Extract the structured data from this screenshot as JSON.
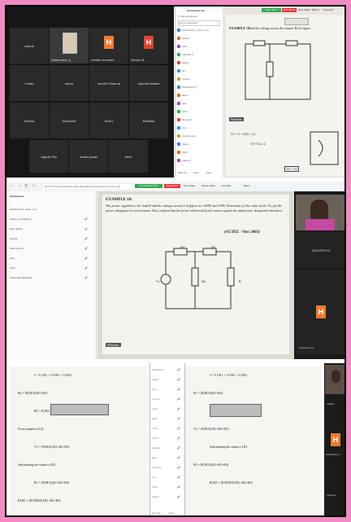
{
  "panel1": {
    "tiles": [
      {
        "label": "salunk"
      },
      {
        "label": "Dashboard_h"
      },
      {
        "label": "reetika chauhan"
      },
      {
        "label": "Simran B"
      },
      {
        "label": "cribab"
      },
      {
        "label": "harsh"
      },
      {
        "label": "nandini Sharma"
      },
      {
        "label": "diya bandhalka"
      },
      {
        "label": "Anisha"
      },
      {
        "label": "Manpreet"
      },
      {
        "label": "Dhruv"
      },
      {
        "label": "Radhika"
      },
      {
        "label": "Jagruti Shy"
      },
      {
        "label": "Aman yadav"
      },
      {
        "label": "Ansh"
      }
    ],
    "avatar_letter": "H",
    "avatar_letter_alt": "H"
  },
  "participants_panel": {
    "title": "Participants (8)",
    "tab": "In call participants",
    "search_placeholder": "Find a participant",
    "items": [
      "Dashboard_h (Host, me)",
      "aakash",
      "ADIJ",
      "Ashmita S",
      "aditya",
      "ajit",
      "Anisha",
      "Dashboard_h",
      "adam",
      "ajay",
      "Ankit",
      "Devansh",
      "Anil",
      "Aman kumar",
      "Akash",
      "Sahil",
      "Aditya S"
    ],
    "buttons": {
      "mute_all": "Mute All",
      "invite": "Invite",
      "more": "More"
    }
  },
  "doc1": {
    "buttons": {
      "start_video": "Start Video",
      "stop_share": "Stop Share",
      "new_share": "New Share",
      "pause": "Pause",
      "annotate": "Annotate"
    },
    "heading": "EXAMPLE 15.",
    "heading_text": "Find the voltage across the resistor R2 in figure.",
    "solution_label": "Solution",
    "eq1": "V1 = 5 + I1(5 + 1)",
    "eq2": "V2 = I2 x 2",
    "ans": "I2 = 1A"
  },
  "browser": {
    "url": "file:///C:/Users/Dashboard_h/Desktop/Electrical/network-theorems.pdf",
    "toolbar": {
      "meeting_id": "ID: 930 066 5572",
      "stop_share": "Stop Share",
      "new_share": "New share",
      "pause": "Pause share",
      "annotate": "Annotate",
      "more": "More"
    },
    "participants_title": "Participants",
    "participants": [
      {
        "name": "Dashboard_h (Host, me)",
        "mute": ""
      },
      {
        "name": "aditya_b (Sarthak ji)",
        "mute": "🎤"
      },
      {
        "name": "tanvi jadhav",
        "mute": "🎤"
      },
      {
        "name": "ananta",
        "mute": "🎤"
      },
      {
        "name": "swati shinde",
        "mute": "🎤"
      },
      {
        "name": "yash",
        "mute": "🎤"
      },
      {
        "name": "Ankit",
        "mute": "🎤"
      },
      {
        "name": "Amber Bandhakalka",
        "mute": "🎤"
      }
    ],
    "example_heading": "EXAMPLE 16:",
    "example_text": "The power supplied to the load R and the voltage across it in figure are 200W and 100V. Determine (i) the value of the Vs, (ii) the power dissipated in each resistor. Also confirm that the power delivered by the source equals the total power dissipated elsewhere.",
    "exam_tag": "(AUJEE - Nov 2003)",
    "r1_label": "5Ω",
    "r2_label": "4Ω",
    "r3_label": "5Ω",
    "r4_label": "R",
    "vs_label": "Vs",
    "solution_label": "Solution:",
    "cam_name": "ARUNPRIYA",
    "cam_name2": "Dashboard_h",
    "avatar_letter": "H"
  },
  "panel3": {
    "eqs_left": [
      "I = V1/R1 + V2/R2 + V3/R3",
      "R2 = (R1R3)/(R1+R3)",
      "RT = R1R2 + R2R3 + R1R3",
      "From equation (10)",
      "V1 = (R1R2)/(R1+R2+R3)",
      "Substituting the values of R2",
      "R1 = (R2R3)/(R1+R2+R3)",
      "R1R2 = (R1R2R3)/(R1+R2+R3)"
    ],
    "eqs_right": [
      "I = V1/R1 + V2/R2 + V3/R3",
      "R1 = (R2R3)/(R1+R2)",
      "From equation (10)",
      "V2 = (R1R3)/(R1+R2+R3)",
      "Substituting the values of R1",
      "R2 = (R1R3)/(R1+R2+R3)",
      "R1R3 = (R1R2R3)/(R1+R2+R3)"
    ],
    "plist_items": [
      "Dashboard",
      "aditya",
      "tanvi",
      "ananta",
      "swati",
      "yash",
      "Ankit",
      "Amber",
      "aakash",
      "ajay",
      "Devansh",
      "Anil",
      "Sahil",
      "Aditya"
    ],
    "cam_labels": [
      "Lakshu",
      "H",
      "Dashboard_h",
      "Lakshya"
    ],
    "plist_mute": "Mute All",
    "plist_invite": "Invite"
  }
}
